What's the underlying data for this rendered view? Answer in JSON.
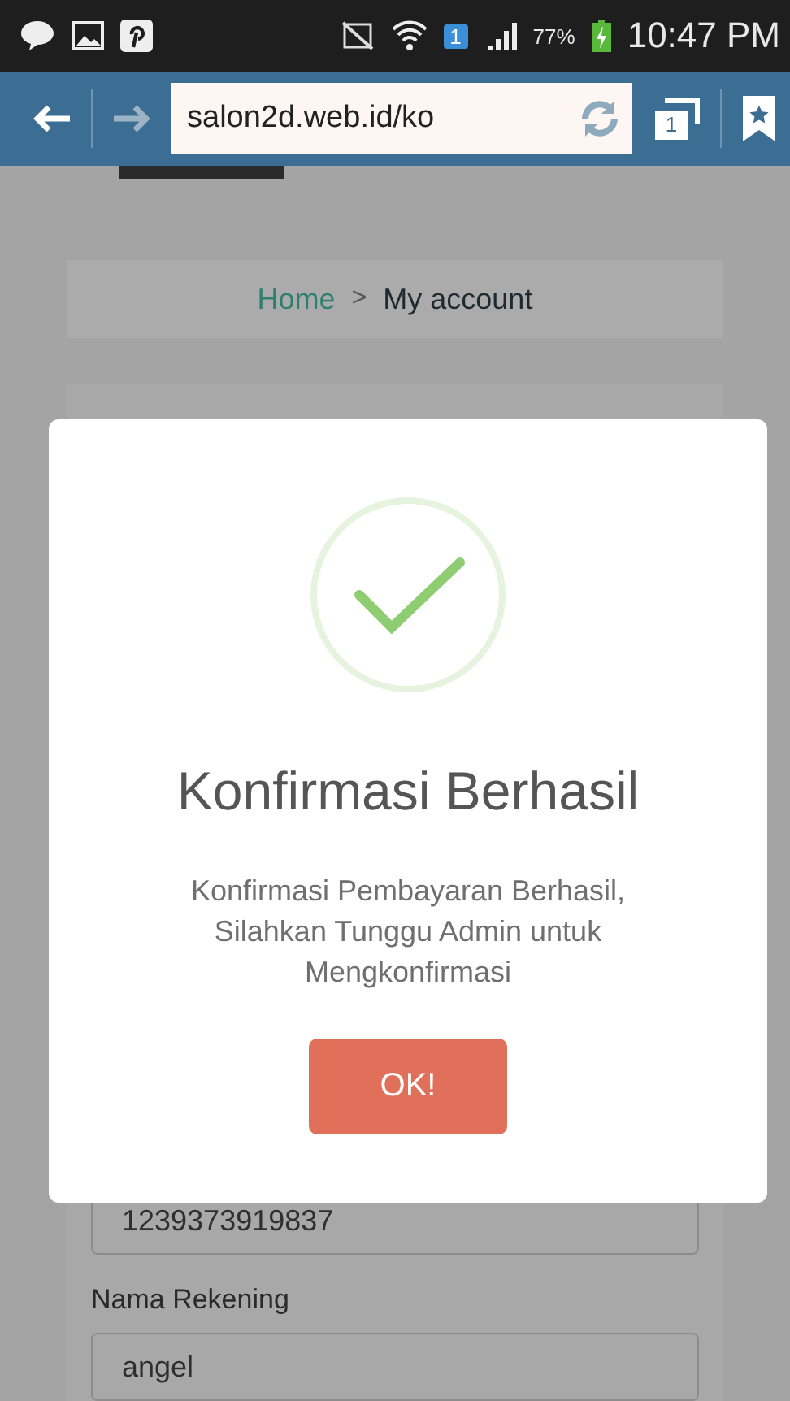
{
  "status_bar": {
    "sim": "1",
    "battery": "77%",
    "time": "10:47 PM"
  },
  "browser": {
    "url": "salon2d.web.id/ko",
    "tab_count": "1"
  },
  "breadcrumb": {
    "items": [
      {
        "label": "Home",
        "kind": "link"
      },
      {
        "label": "My account",
        "kind": "current"
      }
    ],
    "separator": ">"
  },
  "form": {
    "fields": [
      {
        "value": "1239373919837"
      },
      {
        "label": "Nama Rekening",
        "value": "angel"
      }
    ]
  },
  "dialog": {
    "title": "Konfirmasi Berhasil",
    "message_lines": [
      "Konfirmasi Pembayaran Berhasil,",
      "Silahkan Tunggu Admin untuk",
      "Mengkonfirmasi"
    ],
    "button": "OK!"
  }
}
